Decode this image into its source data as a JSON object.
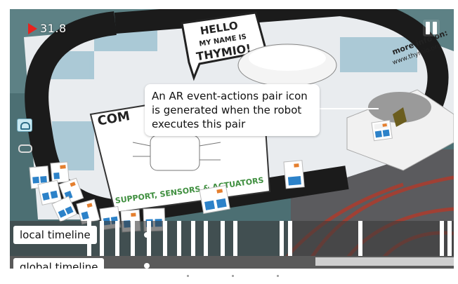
{
  "recording": {
    "time": "31.8",
    "icon": "record-triangle-icon"
  },
  "controls": {
    "pause_icon": "pause-icon"
  },
  "side_icons": [
    {
      "name": "robot-icon"
    },
    {
      "name": "link-icon"
    }
  ],
  "callout": {
    "text": "An AR event-actions pair icon is generated when the robot executes this pair"
  },
  "timelines": {
    "local_label": "local timeline",
    "global_label": "global timeline"
  },
  "board_text": {
    "hello_line1": "HELLO",
    "hello_line2": "MY NAME IS",
    "hello_line3": "THYMIO!",
    "more_info": "more info on:",
    "url": "www.thymio.org",
    "footer": "SUPPORT, SENSORS & ACTUATORS",
    "side_title": "COM"
  },
  "colors": {
    "record": "#e8231e",
    "timeline_tick": "#ffffff",
    "timeline_bar": "#5a5a5a",
    "track": "#1b1b1b"
  }
}
